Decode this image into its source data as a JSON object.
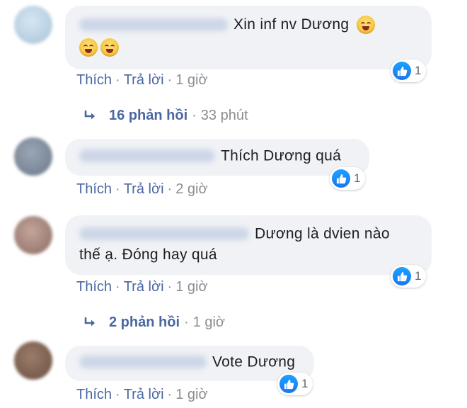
{
  "comments": [
    {
      "text": "Xin inf nv Dương",
      "emoji_icon": "grinning-squinting-face-icon",
      "like_count": "1",
      "actions": {
        "like": "Thích",
        "reply": "Trả lời",
        "time": "1 giờ"
      },
      "replies": {
        "label": "16 phản hồi",
        "time": "33 phút"
      }
    },
    {
      "text": "Thích Dương quá",
      "like_count": "1",
      "actions": {
        "like": "Thích",
        "reply": "Trả lời",
        "time": "2 giờ"
      }
    },
    {
      "text_line1": "Dương là dvien nào",
      "text_line2": "thế ạ. Đóng hay quá",
      "like_count": "1",
      "actions": {
        "like": "Thích",
        "reply": "Trả lời",
        "time": "1 giờ"
      },
      "replies": {
        "label": "2 phản hồi",
        "time": "1 giờ"
      }
    },
    {
      "text": "Vote Dương",
      "like_count": "1",
      "actions": {
        "like": "Thích",
        "reply": "Trả lời",
        "time": "1 giờ"
      }
    }
  ],
  "separator": "·",
  "colors": {
    "link": "#4b67a1",
    "meta": "#8a8d91",
    "bubble": "#f0f2f5",
    "like_blue": "#1877f2"
  }
}
